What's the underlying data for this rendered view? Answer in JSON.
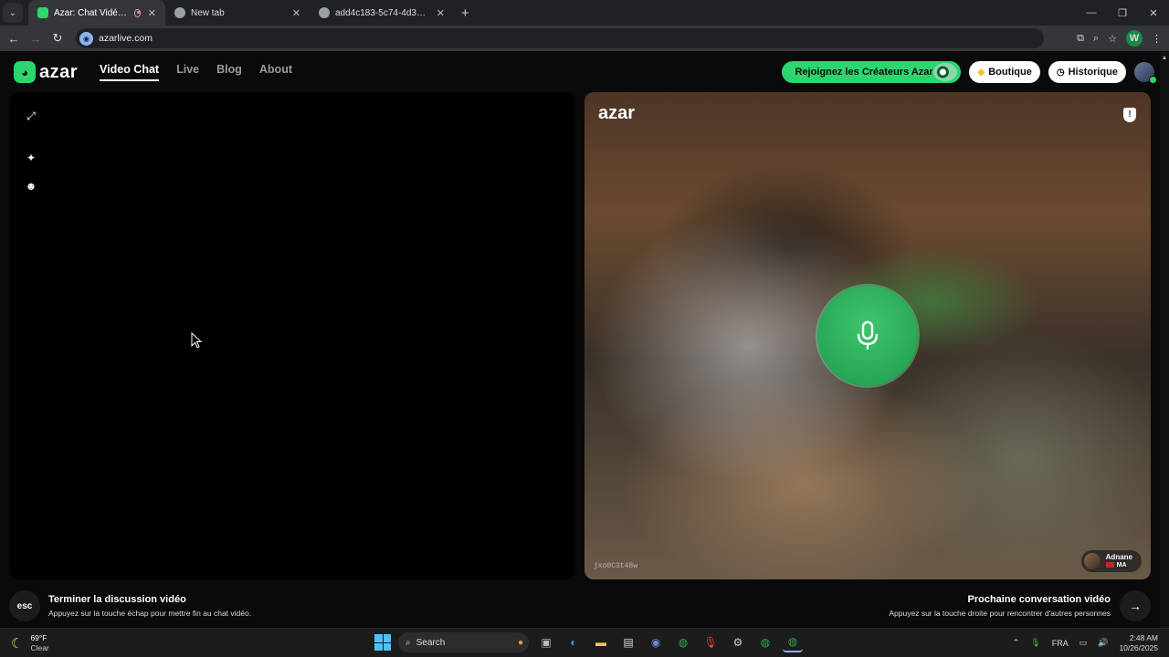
{
  "browser": {
    "tabs": [
      {
        "title": "Azar: Chat Vidéo, Rencontre",
        "active": true
      },
      {
        "title": "New tab",
        "active": false
      },
      {
        "title": "add4c183-5c74-4d31-8721-f2...",
        "active": false
      }
    ],
    "url": "azarlive.com",
    "profile_initial": "W"
  },
  "site": {
    "logo_text": "azar",
    "nav": [
      "Video Chat",
      "Live",
      "Blog",
      "About"
    ],
    "creators_label": "Rejoignez les Créateurs Azar",
    "boutique_label": "Boutique",
    "history_label": "Historique",
    "partner_panel_logo": "azar",
    "user_id": "jxo0C3t48w",
    "peer": {
      "name": "Adnane",
      "country": "MA"
    },
    "end": {
      "key": "esc",
      "title": "Terminer la discussion vidéo",
      "subtitle": "Appuyez sur la touche échap pour mettre fin au chat vidéo."
    },
    "next": {
      "title": "Prochaine conversation vidéo",
      "subtitle": "Appuyez sur la touche droite pour rencontrer d'autres personnes"
    }
  },
  "taskbar": {
    "temp": "69°F",
    "condition": "Clear",
    "search_label": "Search",
    "lang": "FRA",
    "time": "2:48 AM",
    "date": "10/26/2025"
  },
  "colors": {
    "accent": "#2bd66f",
    "mic": "#22a352"
  }
}
